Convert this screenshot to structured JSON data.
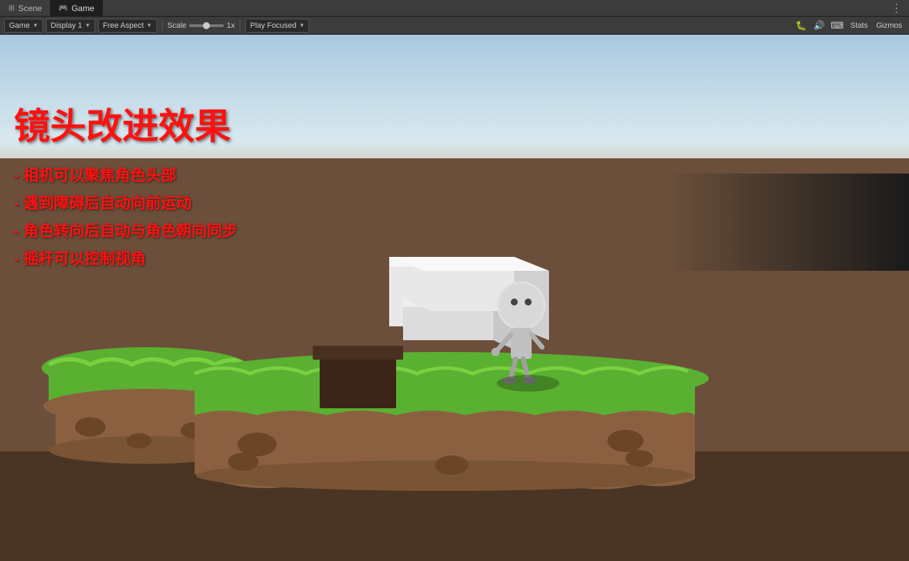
{
  "tabs": [
    {
      "id": "scene",
      "label": "Scene",
      "icon": "⊞",
      "active": false
    },
    {
      "id": "game",
      "label": "Game",
      "icon": "🎮",
      "active": true
    }
  ],
  "toolbar": {
    "game_dropdown": "Game",
    "display_dropdown": "Display 1",
    "aspect_dropdown": "Free Aspect",
    "scale_label": "Scale",
    "scale_value": "1x",
    "play_focused_dropdown": "Play Focused",
    "stats_label": "Stats",
    "gizmos_label": "Gizmos"
  },
  "overlay": {
    "title": "镜头改进效果",
    "bullets": [
      "- 相机可以聚焦角色头部",
      "- 遇到障碍后自动向前运动",
      "- 角色转向后自动与角色朝向同步",
      "- 摇杆可以控制视角"
    ]
  }
}
